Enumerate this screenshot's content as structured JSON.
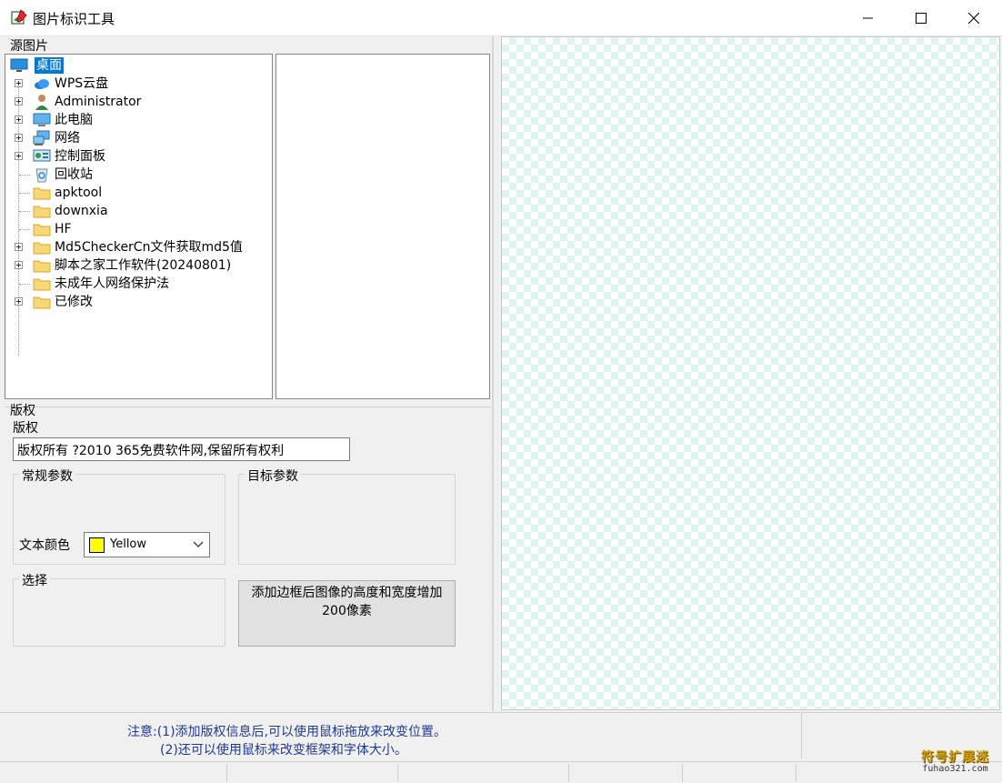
{
  "window": {
    "title": "图片标识工具"
  },
  "source": {
    "group_label": "源图片",
    "tree": [
      {
        "label": "桌面",
        "icon": "desktop-icon",
        "expandable": false,
        "selected": true
      },
      {
        "label": "WPS云盘",
        "icon": "cloud-icon",
        "expandable": true
      },
      {
        "label": "Administrator",
        "icon": "user-icon",
        "expandable": true
      },
      {
        "label": "此电脑",
        "icon": "computer-icon",
        "expandable": true
      },
      {
        "label": "网络",
        "icon": "network-icon",
        "expandable": true
      },
      {
        "label": "控制面板",
        "icon": "control-panel-icon",
        "expandable": true
      },
      {
        "label": "回收站",
        "icon": "recycle-bin-icon",
        "expandable": false
      },
      {
        "label": "apktool",
        "icon": "folder-icon",
        "expandable": false
      },
      {
        "label": "downxia",
        "icon": "folder-icon",
        "expandable": false
      },
      {
        "label": "HF",
        "icon": "folder-icon",
        "expandable": false
      },
      {
        "label": "Md5CheckerCn文件获取md5值",
        "icon": "folder-icon",
        "expandable": true
      },
      {
        "label": "脚本之家工作软件(20240801)",
        "icon": "folder-icon",
        "expandable": true
      },
      {
        "label": "未成年人网络保护法",
        "icon": "folder-icon",
        "expandable": false
      },
      {
        "label": "已修改",
        "icon": "folder-icon",
        "expandable": true
      }
    ]
  },
  "copyright": {
    "group_label": "版权",
    "field_label": "版权",
    "value": "版权所有 ?2010 365免费软件网,保留所有权利",
    "general": {
      "title": "常规参数",
      "color_label": "文本颜色",
      "color_value": "Yellow",
      "color_hex": "#ffff00"
    },
    "target": {
      "title": "目标参数"
    },
    "select": {
      "title": "选择"
    },
    "action_button": "添加边框后图像的高度和宽度增加200像素"
  },
  "notes": {
    "line1": "注意:(1)添加版权信息后,可以使用鼠标拖放来改变位置。",
    "line2": "(2)还可以使用鼠标来改变框架和字体大小。"
  },
  "watermark": {
    "big": "符号扩展迷",
    "small": "fuhao321.com"
  }
}
